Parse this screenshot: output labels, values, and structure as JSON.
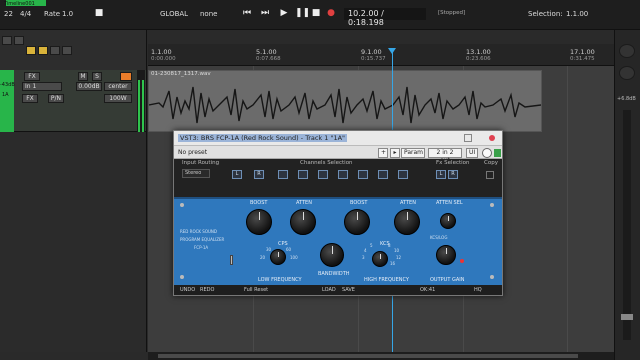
{
  "transport": {
    "project_tab": "Timeline001",
    "bpm": "22",
    "time_sig": "4/4",
    "rate_label": "Rate",
    "rate_value": "1.0",
    "global_label": "GLOBAL",
    "global_mode": "none",
    "position": "10.2.00 / 0:18.198",
    "status": "[Stopped]",
    "selection_label": "Selection:",
    "selection_value": "1.1.00"
  },
  "track": {
    "fx_label": "FX",
    "m_label": "M",
    "s_label": "S",
    "input": "In 1",
    "volume": "0.00dB",
    "pan": "center",
    "width": "100W",
    "fx2_label": "FX",
    "phase_label": "P/N",
    "level_tag": "-43dB",
    "name_tag": "1A"
  },
  "ruler": {
    "bars": [
      {
        "label": "1.1.00",
        "time": "0:00.000"
      },
      {
        "label": "5.1.00",
        "time": "0:07.668"
      },
      {
        "label": "9.1.00",
        "time": "0:15.737"
      },
      {
        "label": "13.1.00",
        "time": "0:23.606"
      },
      {
        "label": "17.1.00",
        "time": "0:31.475"
      }
    ]
  },
  "item": {
    "name": "01-230817_1317.wav"
  },
  "fx_window": {
    "title": "VST3: BRS FCP-1A (Red Rock Sound) - Track 1 \"1A\"",
    "preset": "No preset",
    "plus": "+",
    "param_label": "Param",
    "io_label": "2 in 2 out",
    "ui_label": "UI",
    "input_routing_label": "Input Routing",
    "input_routing_value": "Stereo",
    "channels_selection_label": "Channels Selection",
    "fx_selection_label": "Fx Selection",
    "copy_label": "Copy",
    "ch1": "L",
    "ch2": "R",
    "fx1": "L",
    "fx2": "R",
    "eq": {
      "brand": "RED ROCK SOUND",
      "model": "PROGRAM EQUALIZER",
      "model_code": "FCP-1A",
      "boost1": "BOOST",
      "atten1": "ATTEN",
      "boost2": "BOOST",
      "atten2": "ATTEN",
      "atten_sel": "ATTEN SEL",
      "cps": "CPS",
      "bandwidth": "BANDWIDTH",
      "kcs": "KCS",
      "low_freq": "LOW FREQUENCY",
      "high_freq": "HIGH FREQUENCY",
      "output_gain": "OUTPUT GAIN",
      "kcs_select": "KCS/LOG",
      "cps_values": [
        "20",
        "30",
        "60",
        "100"
      ],
      "kcs_values": [
        "3",
        "4",
        "5",
        "8",
        "10",
        "12",
        "16"
      ]
    },
    "bottom": {
      "undo": "UNDO",
      "redo": "REDO",
      "preset": "Full Reset",
      "load": "LOAD",
      "save": "SAVE",
      "zoom": "OK:41",
      "extra": "HQ"
    }
  },
  "right_strip": {
    "db_label": "+6.8dB"
  }
}
